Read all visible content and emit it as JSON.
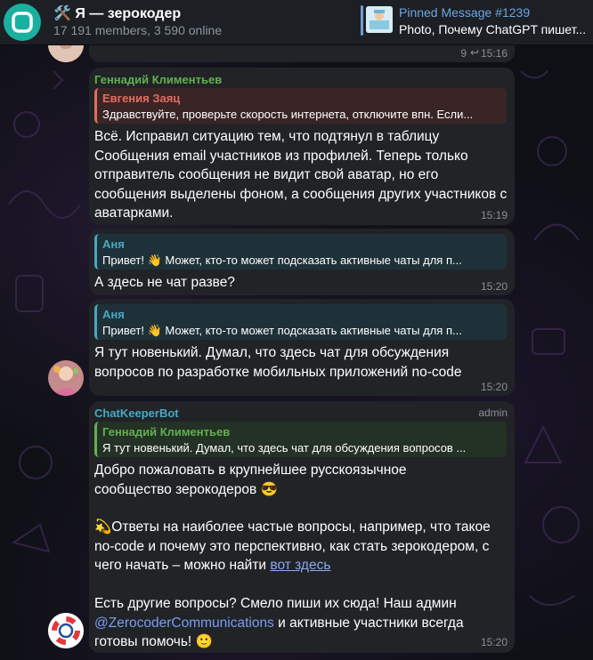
{
  "header": {
    "title": "🛠️ Я — зерокодер",
    "subtitle": "17 191 members, 3 590 online",
    "pinned_title": "Pinned Message #1239",
    "pinned_text": "Photo, Почему ChatGPT пишет..."
  },
  "top_message": {
    "replies": "9",
    "time": "15:16"
  },
  "messages": [
    {
      "sender": "Геннадий Климентьев",
      "reply_name": "Евгения Заяц",
      "reply_text": "Здравствуйте, проверьте скорость интернета, отключите впн. Если...",
      "text": "Всё. Исправил ситуацию тем, что подтянул в таблицу Сообщения email участников из профилей. Теперь только отправитель сообщения не видит свой аватар, но его сообщения выделены фоном, а сообщения других участников с аватарками.",
      "time": "15:19"
    },
    {
      "reply_name": "Аня",
      "reply_text": "Привет! 👋 Может, кто-то может подсказать активные чаты для п...",
      "text": "А здесь не чат разве?",
      "time": "15:20"
    },
    {
      "reply_name": "Аня",
      "reply_text": "Привет! 👋 Может, кто-то может подсказать активные чаты для п...",
      "text": "Я тут новенький. Думал, что здесь чат для обсуждения вопросов по разработке мобильных приложений no-code",
      "time": "15:20"
    },
    {
      "sender": "ChatKeeperBot",
      "badge": "admin",
      "reply_name": "Геннадий Климентьев",
      "reply_text": "Я тут новенький. Думал, что здесь чат для обсуждения вопросов ...",
      "text_1": "Добро пожаловать в крупнейшее русскоязычное сообщество зерокодеров 😎",
      "text_2": "💫Ответы на наиболее частые вопросы, например, что такое no-code и почему это перспективно, как стать зерокодером, с чего начать – можно найти ",
      "link": "вот здесь",
      "text_3": "Есть другие вопросы? Смело пиши их сюда! Наш админ ",
      "mention": "@ZerocoderCommunications",
      "text_4": " и активные участники всегда готовы помочь! 🙂",
      "time": "15:20"
    }
  ],
  "colors": {
    "header_bg": "#1c1f24",
    "bubble_bg": "#212327",
    "name_green": "#62b04e",
    "name_red": "#e36d5d",
    "name_cyan": "#45a9c4",
    "link": "#8aa7f0"
  }
}
